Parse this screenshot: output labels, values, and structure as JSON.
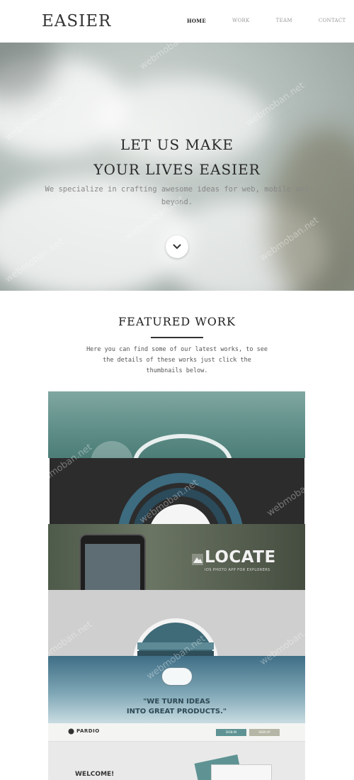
{
  "header": {
    "logo": "EASIER",
    "nav": [
      {
        "label": "HOME",
        "active": true
      },
      {
        "label": "WORK",
        "active": false
      },
      {
        "label": "TEAM",
        "active": false
      },
      {
        "label": "CONTACT",
        "active": false
      }
    ]
  },
  "hero": {
    "title_line1": "LET US MAKE",
    "title_line2": "YOUR LIVES EASIER",
    "subtitle": "We specialize in crafting awesome ideas for web, mobile and beyond.",
    "scroll_icon": "chevron-down-icon"
  },
  "featured": {
    "title": "FEATURED WORK",
    "description": "Here you can find some of our latest works, to see the details of these works just click the thumbnails below."
  },
  "thumbnails": {
    "locate_title": "LOCATE",
    "locate_sub": "IOS PHOTO APP FOR EXPLORERS",
    "turn_text_line1": "\"WE TURN IDEAS",
    "turn_text_line2": "INTO GREAT PRODUCTS.\"",
    "pardio_logo": "PARDIO",
    "pardio_btn1": "SIGN IN",
    "pardio_btn2": "SIGN UP",
    "welcome": "WELCOME!"
  },
  "watermark": "webmoban.net",
  "colors": {
    "accent": "#333333",
    "hero_bg": "#b7c1bd",
    "teal": "#5e8d87"
  }
}
